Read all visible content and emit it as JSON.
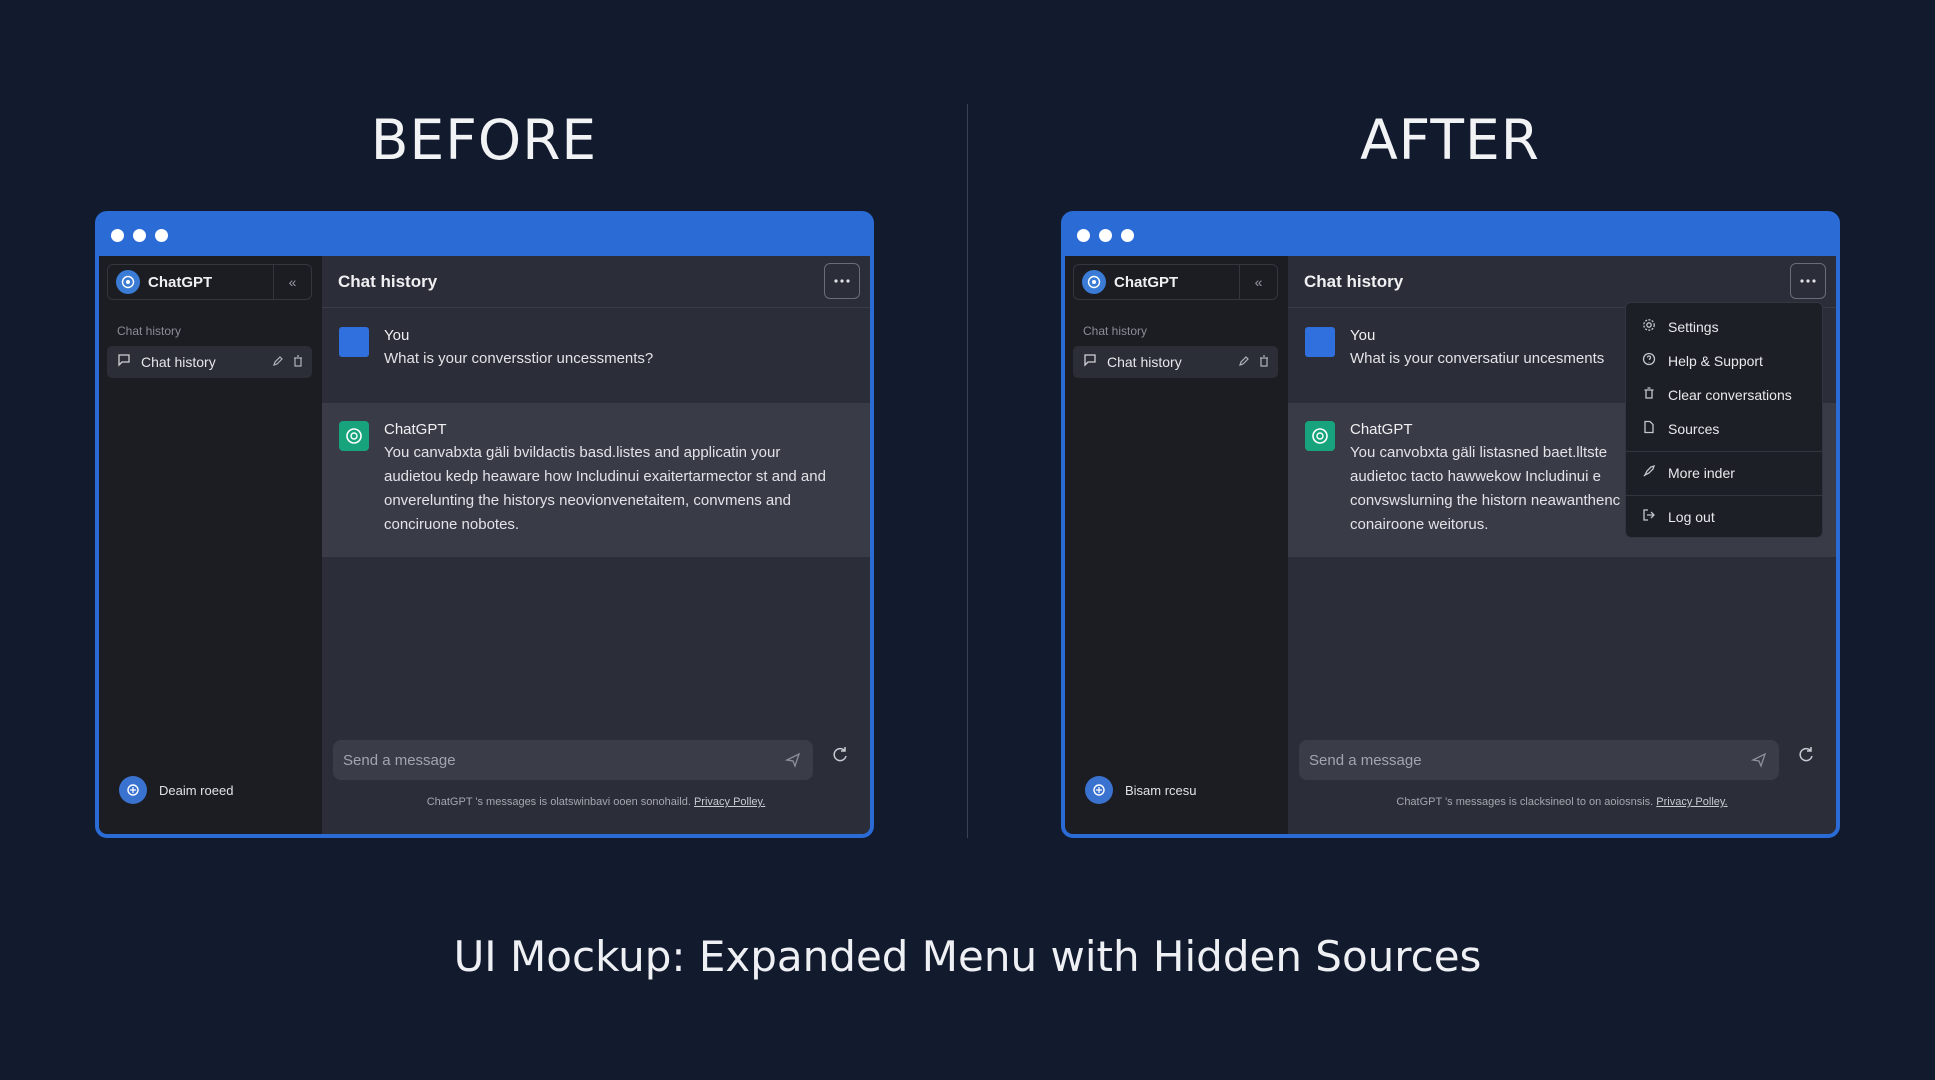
{
  "headings": {
    "before": "BEFORE",
    "after": "AFTER"
  },
  "caption": "UI Mockup: Expanded Menu with Hidden Sources",
  "colors": {
    "background": "#121a2e",
    "accent": "#2a6bd6",
    "bot_avatar": "#17a37c"
  },
  "before": {
    "brand": "ChatGPT",
    "section_label": "Chat history",
    "history_item": "Chat history",
    "header_title": "Chat history",
    "user_msg": {
      "name": "You",
      "text": "What is your conversstior uncessments?"
    },
    "bot_msg": {
      "name": "ChatGPT",
      "lines": [
        "You canvabxta gäli bvildactis basd.listes and applicatin your",
        "audietou kedp heaware how Includinui exaitertarmector st and and",
        "onverelunting the historys neovionvenetaitem, convmens and",
        "conciruone nobotes."
      ]
    },
    "input_placeholder": "Send a message",
    "footer_text": "ChatGPT 's messages is olatswinbavi ooen sonohaild.",
    "footer_link": "Privacy Polley.",
    "user_name": "Deaim roeed"
  },
  "after": {
    "brand": "ChatGPT",
    "section_label": "Chat history",
    "history_item": "Chat history",
    "header_title": "Chat history",
    "user_msg": {
      "name": "You",
      "text": "What is your conversatiur uncesments"
    },
    "bot_msg": {
      "name": "ChatGPT",
      "lines": [
        "You canvobxta gäli listasned baet.lltste",
        "audietoc tacto hawwekow Includinui e",
        "convswslurning the historn neawanthenc",
        "conairoone weitorus."
      ]
    },
    "input_placeholder": "Send a message",
    "footer_text": "ChatGPT 's messages is clacksineol to on aoiosnsis.",
    "footer_link": "Privacy Polley.",
    "user_name": "Bisam rcesu",
    "menu": {
      "items": [
        {
          "label": "Settings",
          "icon": "gear-icon"
        },
        {
          "label": "Help & Support",
          "icon": "help-circle-icon"
        },
        {
          "label": "Clear conversations",
          "icon": "trash-icon"
        },
        {
          "label": "Sources",
          "icon": "document-icon"
        },
        {
          "label": "More inder",
          "icon": "rocket-icon"
        },
        {
          "label": "Log out",
          "icon": "logout-icon"
        }
      ]
    }
  }
}
